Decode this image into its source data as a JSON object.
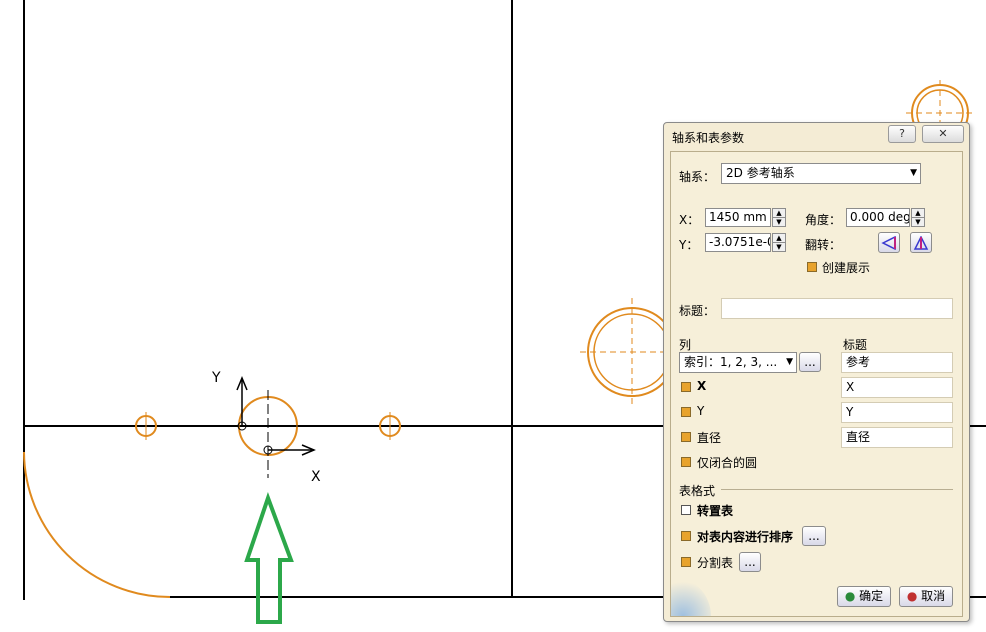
{
  "viewport": {
    "axis_label_y": "Y",
    "axis_label_x": "X"
  },
  "dialog": {
    "title": "轴系和表参数",
    "help_icon": "?",
    "close_icon": "✕",
    "axis_label": "轴系：",
    "axis_value": "2D 参考轴系",
    "x_label": "X：",
    "x_value": "1450 mm",
    "y_label": "Y：",
    "y_value": "-3.0751e-0",
    "angle_label": "角度：",
    "angle_value": "0.000 deg",
    "flip_label": "翻转：",
    "create_show_label": "创建展示",
    "create_show_checked": true,
    "heading_label": "标题：",
    "heading_value": "",
    "columns_label": "列",
    "columns_title_label": "标题",
    "index_select": "索引：1, 2, 3, ...",
    "more_button": "...",
    "index_title": "参考",
    "rows": [
      {
        "label": "X",
        "title": "X",
        "checked": true,
        "bold": true
      },
      {
        "label": "Y",
        "title": "Y",
        "checked": true,
        "bold": false
      },
      {
        "label": "直径",
        "title": "直径",
        "checked": true,
        "bold": false
      },
      {
        "label": "仅闭合的圆",
        "title": "",
        "checked": true,
        "bold": false
      }
    ],
    "table_format_label": "表格式",
    "transpose_label": "转置表",
    "transpose_checked": false,
    "sort_label": "对表内容进行排序",
    "sort_checked": true,
    "split_label": "分割表",
    "split_checked": true,
    "ok_label": "确定",
    "cancel_label": "取消"
  },
  "colors": {
    "geometry": "#e08a1e",
    "green_arrow": "#2ca84a",
    "dialog_bg": "#f4ecd5"
  }
}
